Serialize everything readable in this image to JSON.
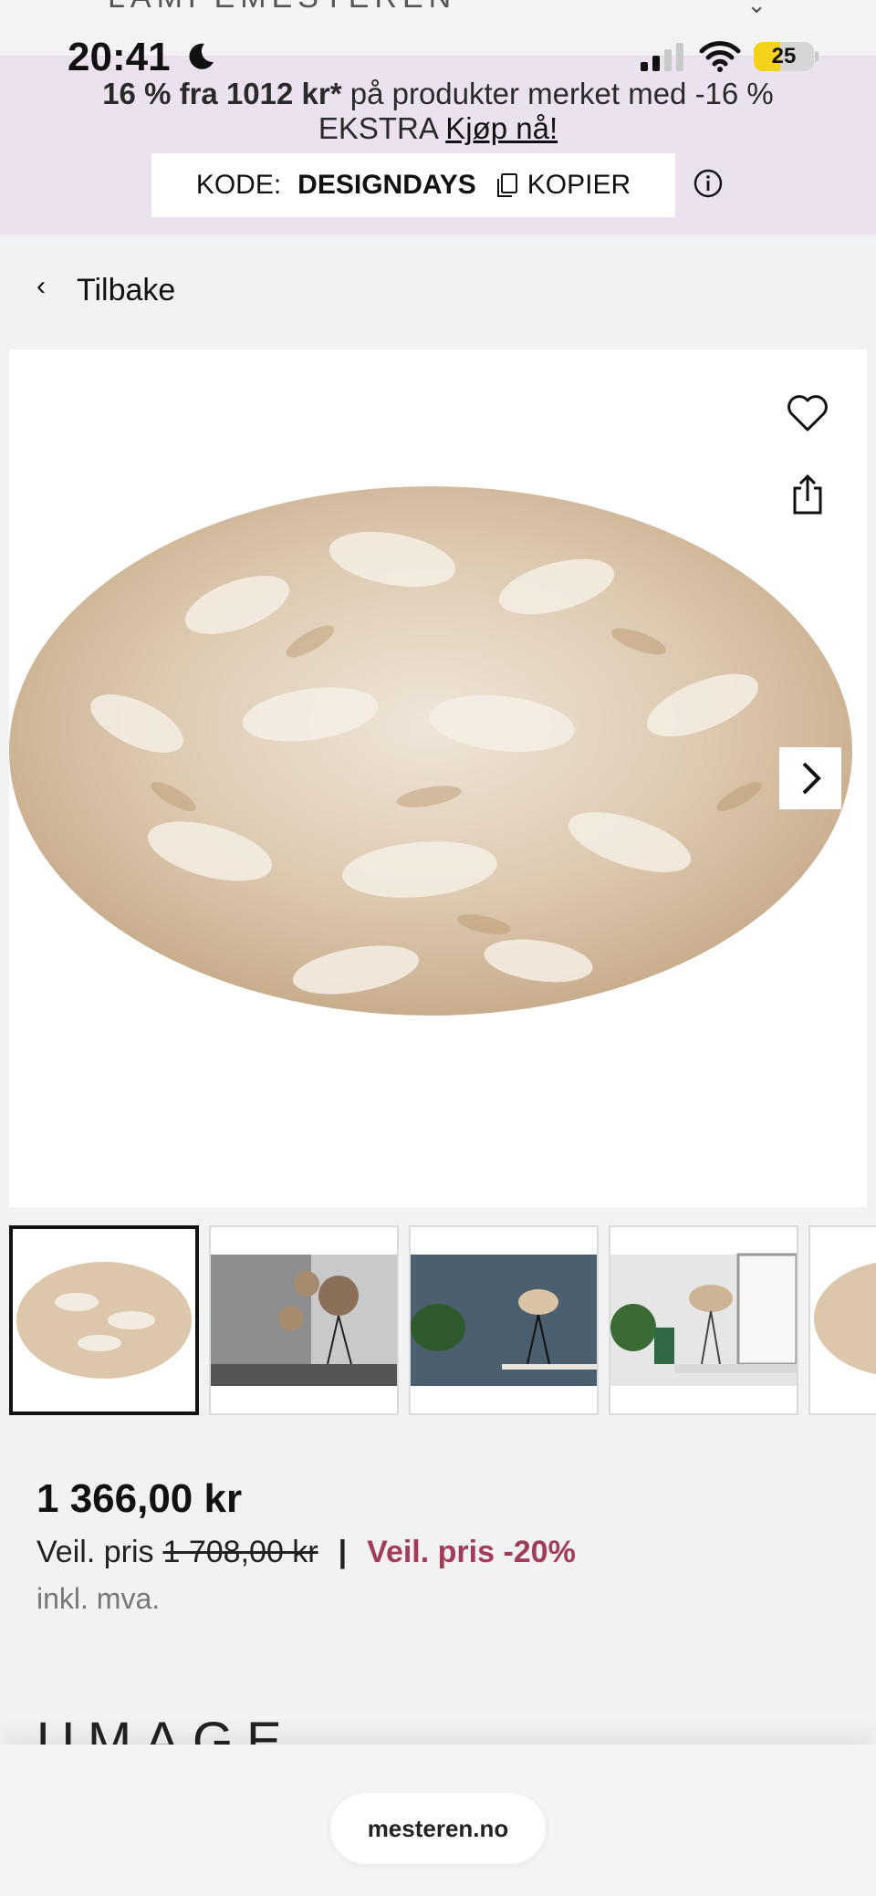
{
  "site": {
    "logo_text": "LAMPEMESTEREN"
  },
  "status_bar": {
    "time": "20:41",
    "battery": "25",
    "battery_level": 0.25
  },
  "promo": {
    "line1_bold": "16 % fra 1012 kr*",
    "line1_rest": " på produkter merket med -16 %",
    "line2_text": "EKSTRA ",
    "line2_cta": "Kjøp nå!",
    "code_label": "KODE:",
    "code_value": "DESIGNDAYS",
    "copy_label": "KOPIER"
  },
  "nav": {
    "back_label": "Tilbake"
  },
  "gallery": {
    "thumbnails": [
      "feather-shade",
      "floor-lamps-room",
      "floor-lamp-blue-wall",
      "lamp-window",
      "feather-shade-2"
    ],
    "active_index": 0
  },
  "product": {
    "price": "1 366,00 kr",
    "rec_label": "Veil. pris",
    "old_price": "1 708,00 kr",
    "separator": "|",
    "discount_label": "Veil. pris -20%",
    "vat_note": "inkl. mva.",
    "brand_peek": "UMAGE"
  },
  "browser": {
    "url": "mesteren.no"
  },
  "colors": {
    "promo_bg": "#ece1ef",
    "discount": "#a13c59",
    "battery": "#f5d21a"
  }
}
